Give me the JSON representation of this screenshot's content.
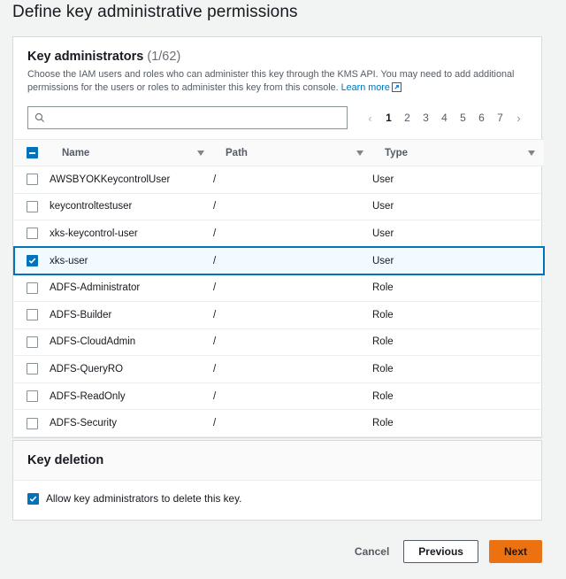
{
  "page": {
    "title": "Define key administrative permissions"
  },
  "key_administrators": {
    "heading": "Key administrators",
    "count": "(1/62)",
    "description_line1": "Choose the IAM users and roles who can administer this key through the KMS API. You may need to add additional permissions for the users",
    "description_line2": "or roles to administer this key from this console.",
    "learn_more_label": "Learn more",
    "learn_more_icon": "external-link-icon",
    "search": {
      "icon": "search-icon",
      "value": "",
      "placeholder": ""
    },
    "pagination": {
      "prev_icon": "chevron-left-icon",
      "next_icon": "chevron-right-icon",
      "pages": [
        "1",
        "2",
        "3",
        "4",
        "5",
        "6",
        "7"
      ],
      "current": "1"
    },
    "table": {
      "select_all_state": "indeterminate",
      "columns": [
        {
          "label": "Name",
          "sort_icon": "sort-caret-icon"
        },
        {
          "label": "Path",
          "sort_icon": "sort-caret-icon"
        },
        {
          "label": "Type",
          "sort_icon": "sort-caret-icon"
        }
      ],
      "rows": [
        {
          "selected": false,
          "name": "AWSBYOKKeycontrolUser",
          "path": "/",
          "type": "User"
        },
        {
          "selected": false,
          "name": "keycontroltestuser",
          "path": "/",
          "type": "User"
        },
        {
          "selected": false,
          "name": "xks-keycontrol-user",
          "path": "/",
          "type": "User"
        },
        {
          "selected": true,
          "name": "xks-user",
          "path": "/",
          "type": "User"
        },
        {
          "selected": false,
          "name": "ADFS-Administrator",
          "path": "/",
          "type": "Role"
        },
        {
          "selected": false,
          "name": "ADFS-Builder",
          "path": "/",
          "type": "Role"
        },
        {
          "selected": false,
          "name": "ADFS-CloudAdmin",
          "path": "/",
          "type": "Role"
        },
        {
          "selected": false,
          "name": "ADFS-QueryRO",
          "path": "/",
          "type": "Role"
        },
        {
          "selected": false,
          "name": "ADFS-ReadOnly",
          "path": "/",
          "type": "Role"
        },
        {
          "selected": false,
          "name": "ADFS-Security",
          "path": "/",
          "type": "Role"
        }
      ]
    }
  },
  "key_deletion": {
    "heading": "Key deletion",
    "checkbox_checked": true,
    "checkbox_label": "Allow key administrators to delete this key."
  },
  "footer": {
    "cancel_label": "Cancel",
    "previous_label": "Previous",
    "next_label": "Next"
  },
  "colors": {
    "accent_blue": "#0073bb",
    "primary_orange": "#ec7211",
    "page_background": "#f2f3f3",
    "selected_row": "#f1faff",
    "border": "#d5dbdb"
  }
}
